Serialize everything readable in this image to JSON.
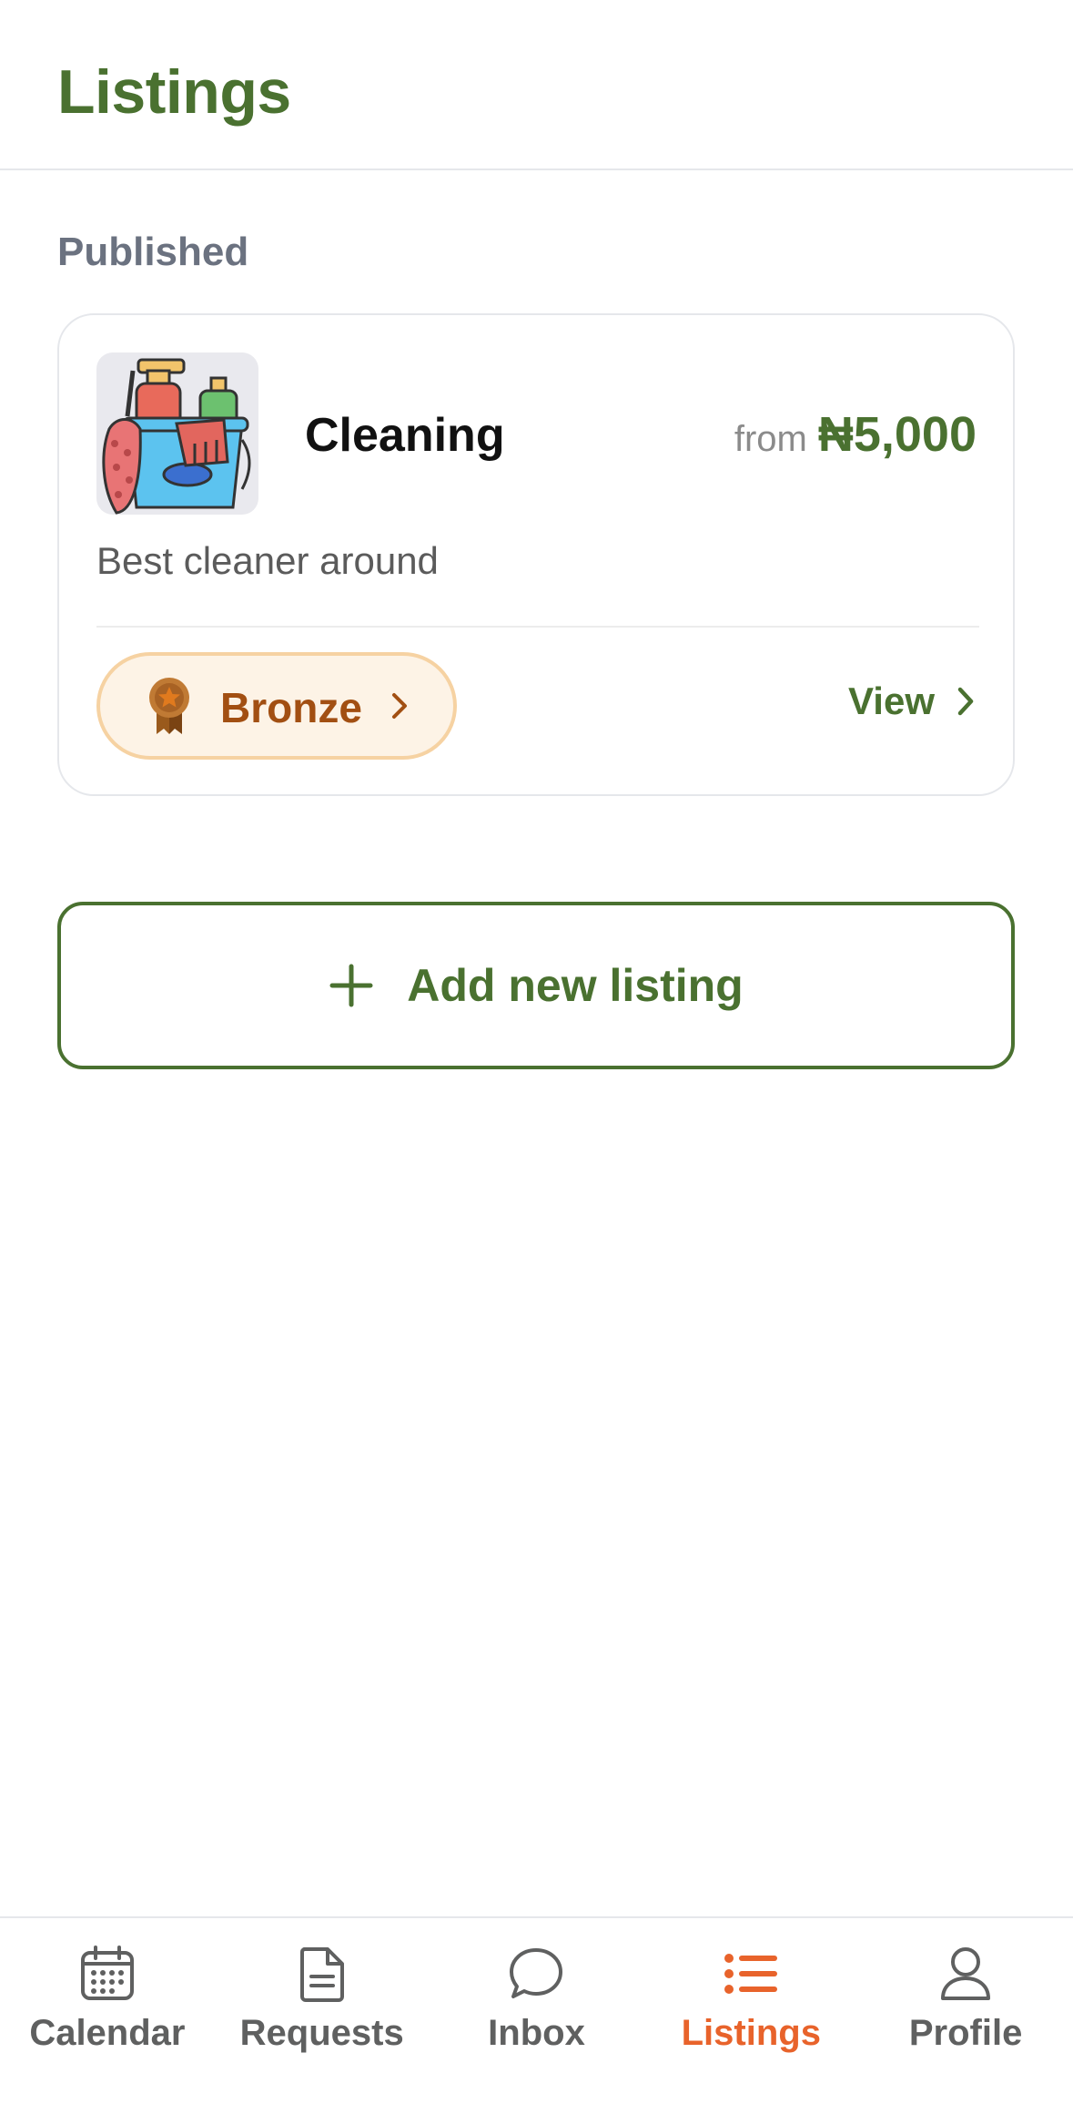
{
  "header": {
    "title": "Listings"
  },
  "sections": {
    "published_label": "Published"
  },
  "listing": {
    "title": "Cleaning",
    "price_prefix": "from",
    "price": "₦5,000",
    "description": "Best cleaner around",
    "tier": "Bronze",
    "view_label": "View",
    "thumbnail_icon": "cleaning-supplies-bucket"
  },
  "add_button": {
    "label": "Add new listing",
    "icon": "plus-icon"
  },
  "tabbar": {
    "items": [
      {
        "label": "Calendar",
        "icon": "calendar-icon",
        "active": false
      },
      {
        "label": "Requests",
        "icon": "document-icon",
        "active": false
      },
      {
        "label": "Inbox",
        "icon": "chat-bubble-icon",
        "active": false
      },
      {
        "label": "Listings",
        "icon": "list-icon",
        "active": true
      },
      {
        "label": "Profile",
        "icon": "person-icon",
        "active": false
      }
    ]
  },
  "colors": {
    "brand_green": "#4a7130",
    "accent_orange": "#e8632b",
    "bronze_text": "#a24f12",
    "bronze_bg": "#fdf3e6",
    "muted_text": "#6b7280"
  }
}
